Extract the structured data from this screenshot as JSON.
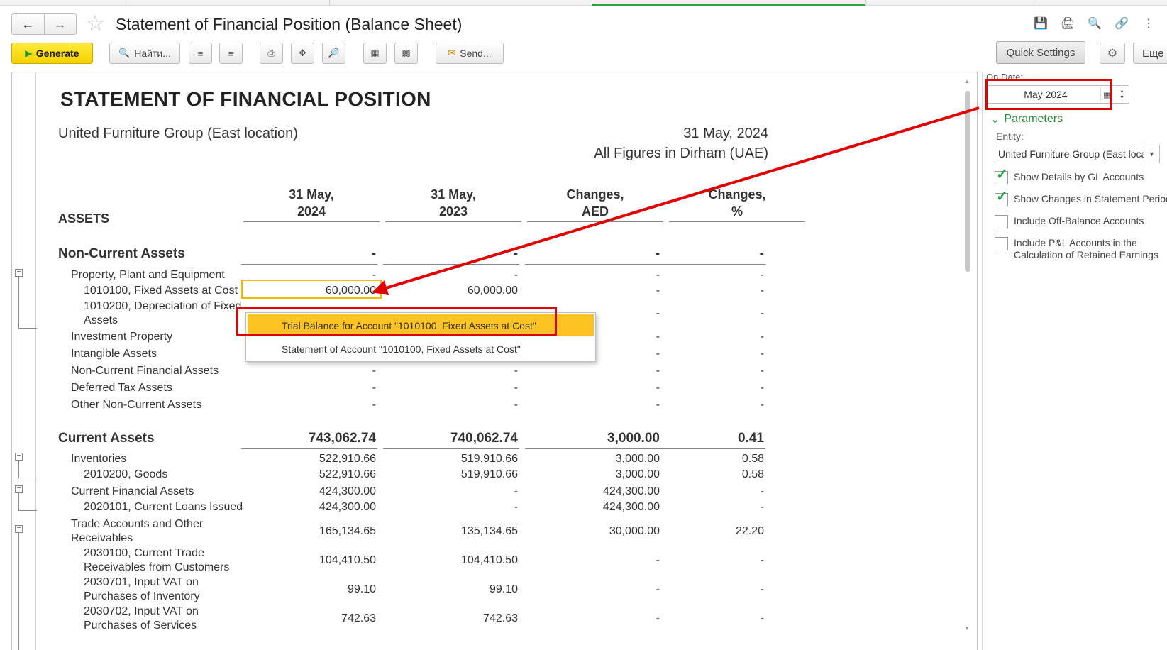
{
  "window": {
    "title": "Statement of Financial Position (Balance Sheet)"
  },
  "toolbar": {
    "generate_label": "Generate",
    "find_label": "Найти...",
    "send_label": "Send..."
  },
  "report": {
    "title": "STATEMENT OF FINANCIAL POSITION",
    "company": "United Furniture Group (East location)",
    "date": "31 May, 2024",
    "figures_note": "All Figures in Dirham (UAE)",
    "columns": [
      {
        "line1": "31 May,",
        "line2": "2024"
      },
      {
        "line1": "31 May,",
        "line2": "2023"
      },
      {
        "line1": "Changes,",
        "line2": "AED"
      },
      {
        "line1": "Changes,",
        "line2": "%"
      }
    ],
    "assets_label": "ASSETS",
    "rows": [
      {
        "label": "Non-Current Assets",
        "values": [
          "-",
          "-",
          "-",
          "-"
        ]
      },
      {
        "label": "Property, Plant and Equipment",
        "values": [
          "-",
          "-",
          "-",
          "-"
        ]
      },
      {
        "label": "1010100, Fixed Assets at Cost",
        "values": [
          "60,000.00",
          "60,000.00",
          "-",
          "-"
        ]
      },
      {
        "label": "1010200, Depreciation of Fixed",
        "label2": "Assets",
        "values": [
          "",
          "",
          "-",
          "-"
        ]
      },
      {
        "label": "Investment Property",
        "values": [
          "",
          "",
          "-",
          "-"
        ]
      },
      {
        "label": "Intangible Assets",
        "values": [
          "-",
          "-",
          "-",
          "-"
        ]
      },
      {
        "label": "Non-Current Financial Assets",
        "values": [
          "-",
          "-",
          "-",
          "-"
        ]
      },
      {
        "label": "Deferred Tax Assets",
        "values": [
          "-",
          "-",
          "-",
          "-"
        ]
      },
      {
        "label": "Other Non-Current Assets",
        "values": [
          "-",
          "-",
          "-",
          "-"
        ]
      },
      {
        "label": "Current Assets",
        "values": [
          "743,062.74",
          "740,062.74",
          "3,000.00",
          "0.41"
        ]
      },
      {
        "label": "Inventories",
        "values": [
          "522,910.66",
          "519,910.66",
          "3,000.00",
          "0.58"
        ]
      },
      {
        "label": "2010200, Goods",
        "values": [
          "522,910.66",
          "519,910.66",
          "3,000.00",
          "0.58"
        ]
      },
      {
        "label": "Current Financial Assets",
        "values": [
          "424,300.00",
          "-",
          "424,300.00",
          "-"
        ]
      },
      {
        "label": "2020101, Current Loans Issued",
        "values": [
          "424,300.00",
          "-",
          "424,300.00",
          "-"
        ]
      },
      {
        "label": "Trade Accounts and Other",
        "label2": "Receivables",
        "values": [
          "165,134.65",
          "135,134.65",
          "30,000.00",
          "22.20"
        ]
      },
      {
        "label": "2030100, Current Trade",
        "label2": "Receivables from Customers",
        "values": [
          "104,410.50",
          "104,410.50",
          "-",
          "-"
        ]
      },
      {
        "label": "2030701, Input VAT on",
        "label2": "Purchases of Inventory",
        "values": [
          "99.10",
          "99.10",
          "-",
          "-"
        ]
      },
      {
        "label": "2030702, Input VAT on",
        "label2": "Purchases of Services",
        "values": [
          "742.63",
          "742.63",
          "-",
          "-"
        ]
      }
    ]
  },
  "context_menu": {
    "items": [
      "Trial Balance for Account \"1010100, Fixed Assets at Cost\"",
      "Statement of Account \"1010100, Fixed Assets at Cost\""
    ]
  },
  "settings": {
    "quick_settings_label": "Quick Settings",
    "more_label": "Еще",
    "on_date_label": "On Date:",
    "on_date_value": "May 2024",
    "parameters_label": "Parameters",
    "entity_label": "Entity:",
    "entity_value": "United Furniture Group (East location)",
    "checkboxes": [
      {
        "label": "Show Details by GL Accounts",
        "checked": true
      },
      {
        "label": "Show Changes in Statement Period",
        "checked": true
      },
      {
        "label": "Include Off-Balance Accounts",
        "checked": false
      },
      {
        "label": "Include P&L Accounts in the",
        "label2": "Calculation of Retained Earnings",
        "checked": false
      }
    ]
  },
  "colors": {
    "accent_green": "#2aa34a",
    "generate_yellow": "#f5d100",
    "menu_highlight": "#fcc322",
    "annotation_red": "#e00000"
  }
}
